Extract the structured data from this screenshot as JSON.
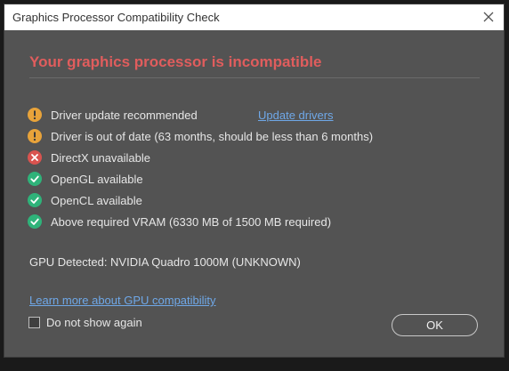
{
  "window": {
    "title": "Graphics Processor Compatibility Check",
    "close_icon": "close-icon"
  },
  "heading": "Your graphics processor is incompatible",
  "checks": [
    {
      "status": "warning",
      "icon": "warning-icon",
      "color": "#e8a33a",
      "label": "Driver update recommended"
    },
    {
      "status": "warning",
      "icon": "warning-icon",
      "color": "#e8a33a",
      "label": "Driver is out of date (63 months, should be less than 6 months)"
    },
    {
      "status": "error",
      "icon": "error-icon",
      "color": "#d9534f",
      "label": "DirectX unavailable"
    },
    {
      "status": "ok",
      "icon": "checkmark-icon",
      "color": "#2fb37a",
      "label": "OpenGL available"
    },
    {
      "status": "ok",
      "icon": "checkmark-icon",
      "color": "#2fb37a",
      "label": "OpenCL available"
    },
    {
      "status": "ok",
      "icon": "checkmark-icon",
      "color": "#2fb37a",
      "label": "Above required VRAM (6330 MB of 1500 MB required)"
    }
  ],
  "update_drivers_link": "Update drivers",
  "gpu_detected": "GPU Detected: NVIDIA Quadro 1000M (UNKNOWN)",
  "learn_more_link": "Learn more about GPU compatibility",
  "do_not_show_again": {
    "label": "Do not show again",
    "checked": false
  },
  "ok_button": "OK",
  "colors": {
    "heading": "#e05d5d",
    "link": "#6fa8e8",
    "dialog_background": "#535353"
  }
}
